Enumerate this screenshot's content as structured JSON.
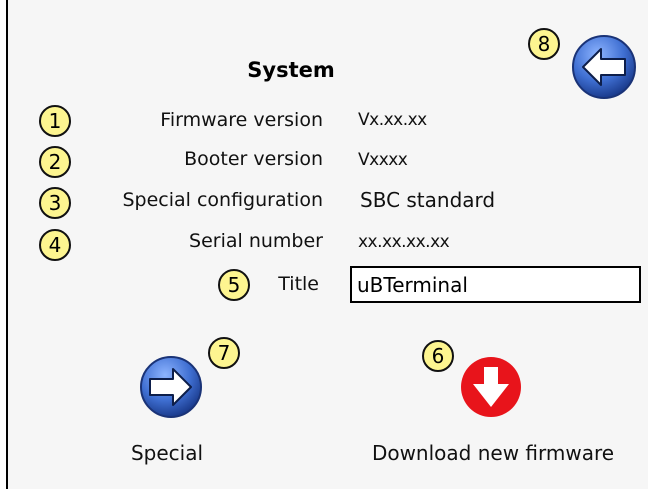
{
  "page": {
    "title": "System"
  },
  "badges": [
    "1",
    "2",
    "3",
    "4",
    "5",
    "6",
    "7",
    "8"
  ],
  "info": {
    "firmware_label": "Firmware version",
    "firmware_value": "Vx.xx.xx",
    "booter_label": "Booter version",
    "booter_value": "Vxxxx",
    "config_label": "Special configuration",
    "config_value": "SBC standard",
    "serial_label": "Serial number",
    "serial_value": "xx.xx.xx.xx"
  },
  "title_field": {
    "label": "Title",
    "value": "uBTerminal"
  },
  "actions": {
    "special_label": "Special",
    "download_label": "Download new firmware"
  },
  "colors": {
    "badge_fill": "#fdf590",
    "arrow_blue": "#3f6fd2",
    "download_red": "#e8141b"
  },
  "icons": {
    "back": "back-arrow-icon",
    "special": "forward-arrow-icon",
    "download": "download-arrow-icon"
  }
}
